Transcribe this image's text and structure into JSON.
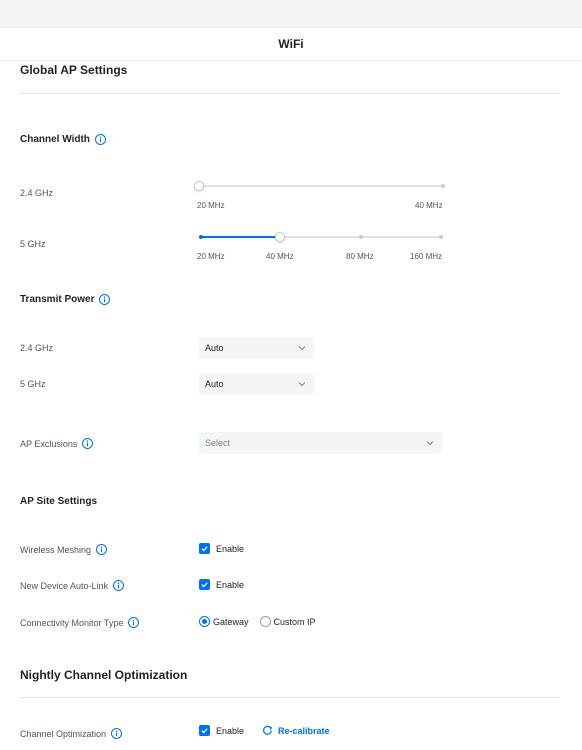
{
  "header": {
    "title": "WiFi"
  },
  "global_ap": {
    "title": "Global AP Settings",
    "channel_width": {
      "title": "Channel Width",
      "rows": [
        {
          "label": "2.4 GHz",
          "options": [
            "20 MHz",
            "40 MHz"
          ],
          "selected": "20 MHz"
        },
        {
          "label": "5 GHz",
          "options": [
            "20 MHz",
            "40 MHz",
            "80 MHz",
            "160 MHz"
          ],
          "selected": "40 MHz"
        }
      ]
    },
    "transmit_power": {
      "title": "Transmit Power",
      "rows": [
        {
          "label": "2.4 GHz",
          "value": "Auto"
        },
        {
          "label": "5 GHz",
          "value": "Auto"
        }
      ]
    },
    "ap_exclusions": {
      "label": "AP Exclusions",
      "placeholder": "Select"
    }
  },
  "site": {
    "title": "AP Site Settings",
    "wireless_meshing": {
      "label": "Wireless Meshing",
      "option": "Enable",
      "checked": true
    },
    "auto_link": {
      "label": "New Device Auto-Link",
      "option": "Enable",
      "checked": true
    },
    "monitor": {
      "label": "Connectivity Monitor Type",
      "options": [
        "Gateway",
        "Custom IP"
      ],
      "selected": "Gateway"
    }
  },
  "nightly": {
    "title": "Nightly Channel Optimization",
    "channel_opt": {
      "label": "Channel Optimization",
      "option": "Enable",
      "checked": true,
      "action": "Re-calibrate"
    }
  },
  "colors": {
    "accent": "#006fff",
    "track": "#dfe1e5",
    "field_bg": "#f4f5f6"
  },
  "icons": {
    "info": "info-icon",
    "check": "checkmark-icon",
    "chevron": "chevron-down-icon",
    "refresh": "refresh-icon"
  }
}
